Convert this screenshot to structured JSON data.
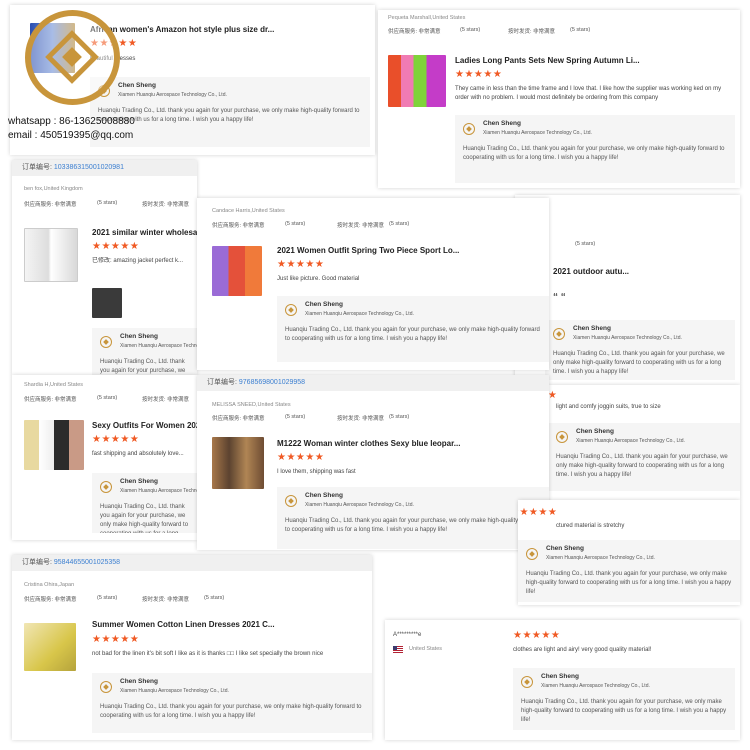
{
  "brand": {
    "whatsapp": "whatsapp : 86-13625008880",
    "email": "email : 450519395@qq.com",
    "logo_color": "#c8953b"
  },
  "labels": {
    "order_prefix": "订单编号: ",
    "supplier_service": "供应商服务: 非常满意",
    "on_time": "按时发货: 非常满意",
    "five_stars": "(5 stars)",
    "stars": "★★★★★"
  },
  "colors": {
    "star": "#f05a24",
    "order_link": "#3b7fd1"
  },
  "reply": {
    "name": "Chen Sheng",
    "company": "Xiamen Huanqiu Aerospace Technology Co., Ltd.",
    "text": "Huanqiu Trading Co., Ltd. thank you again for your purchase, we only make high-quality forward to cooperating with us for a long time. I wish you a happy life!"
  },
  "reviews": [
    {
      "id": "r1",
      "title": "African women's Amazon hot style plus size dr...",
      "comment": "beautiful dresses"
    },
    {
      "id": "r2",
      "buyer": "Pequeta Marshall,United States",
      "title": "Ladies Long Pants Sets New Spring Autumn Li...",
      "comment": "They came in less than the time frame and I love that. I like how the supplier was working ked on my order with no problem. I would most definitely be ordering from this company"
    },
    {
      "id": "r3",
      "order": "10338631500102098​1",
      "buyer": "ben fox,United Kingdom",
      "title": "2021 similar winter wholesa...",
      "comment": "已修改: amazing jacket perfect k..."
    },
    {
      "id": "r4",
      "buyer": "Candace Harris,United States",
      "title": "2021 Women Outfit Spring Two Piece Sport Lo...",
      "comment": "Just like picture. Good material"
    },
    {
      "id": "r5",
      "title": "2021 outdoor autu...",
      "comment": "“ “"
    },
    {
      "id": "r6",
      "buyer": "Shardia H,United States",
      "title": "Sexy Outfits For Women 202...",
      "comment": "fast shipping and absolutely love..."
    },
    {
      "id": "r7",
      "order": "97685698001029958",
      "buyer": "MELISSA SNEED,United States",
      "title": "M1222 Woman winter clothes Sexy blue leopar...",
      "comment": "I love them, shipping was fast"
    },
    {
      "id": "r8",
      "comment": "light and comfy joggin suits, true to size"
    },
    {
      "id": "r9",
      "comment": "ctured material is stretchy"
    },
    {
      "id": "r10",
      "order": "9584465500102535​8",
      "buyer": "Cristina Ohira,Japan",
      "title": "Summer Women Cotton Linen Dresses 2021 C...",
      "comment": "not bad for the linen it's bit soft I like as it is thanks □□ I like set specially the brown nice"
    },
    {
      "id": "r11",
      "buyer": "A*********e",
      "country": "United States",
      "comment": "clothes are light and airy! very good quality material!"
    }
  ]
}
